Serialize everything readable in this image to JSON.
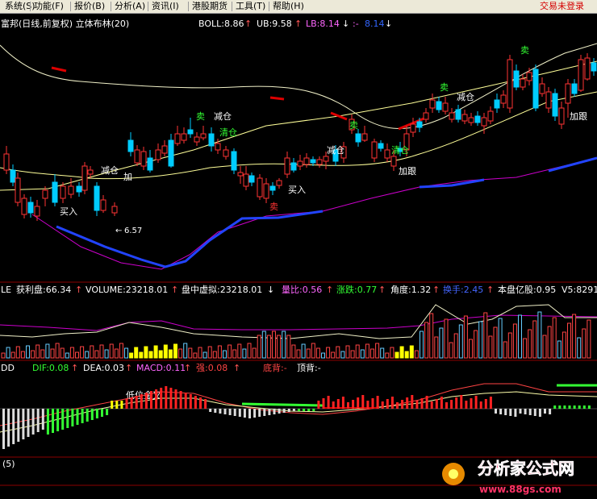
{
  "menu": {
    "items": [
      "系统(S)",
      "功能(F)",
      "报价(B)",
      "分析(A)",
      "资讯(I)",
      "港股期货",
      "工具(T)",
      "帮助(H)"
    ],
    "login": "交易未登录"
  },
  "main_panel": {
    "title": "富邦(日线,前复权) 立体布林(20)",
    "boll": "BOLL:8.86",
    "ub": "UB:9.58",
    "lb": "LB:8.14",
    "extra": "8.14",
    "low_label": "6.57",
    "annotations": {
      "buy": "买入",
      "sell": "卖",
      "reduce": "减仓",
      "clear": "清仓",
      "add": "加",
      "add_follow": "加跟"
    }
  },
  "volume_panel": {
    "prefix": "LE",
    "profit": "获利盘:66.34",
    "volume": "VOLUME:23218.01",
    "intraday": "盘中虚拟:23218.01",
    "vol_ratio": "量比:0.56",
    "change": "涨跌:0.77",
    "angle": "角度:1.32",
    "turnover": "换手:2.45",
    "shares": "本盘亿股:0.95",
    "v5": "V5:8291"
  },
  "macd_panel": {
    "prefix": "DD",
    "dif": "DIF:0.08",
    "dea": "DEA:0.03",
    "macd": "MACD:0.11",
    "strong": "强:0.08",
    "bottom_div": "底背:-",
    "top_div": "顶背:-",
    "golden_cross": "低位金叉"
  },
  "bottom_panel": {
    "label": "(5)"
  },
  "watermark": {
    "name": "分析家公式网",
    "url": "www.88gs.com"
  },
  "colors": {
    "up": "#ff3333",
    "down": "#00ccff",
    "boll_mid": "#ffff99",
    "lb_line": "#cc00cc",
    "blue_line": "#3366ff",
    "green": "#33ff33",
    "yellow": "#ffff00",
    "magenta": "#ff33ff",
    "menu_bg": "#ece9d8",
    "login": "#d40000"
  }
}
